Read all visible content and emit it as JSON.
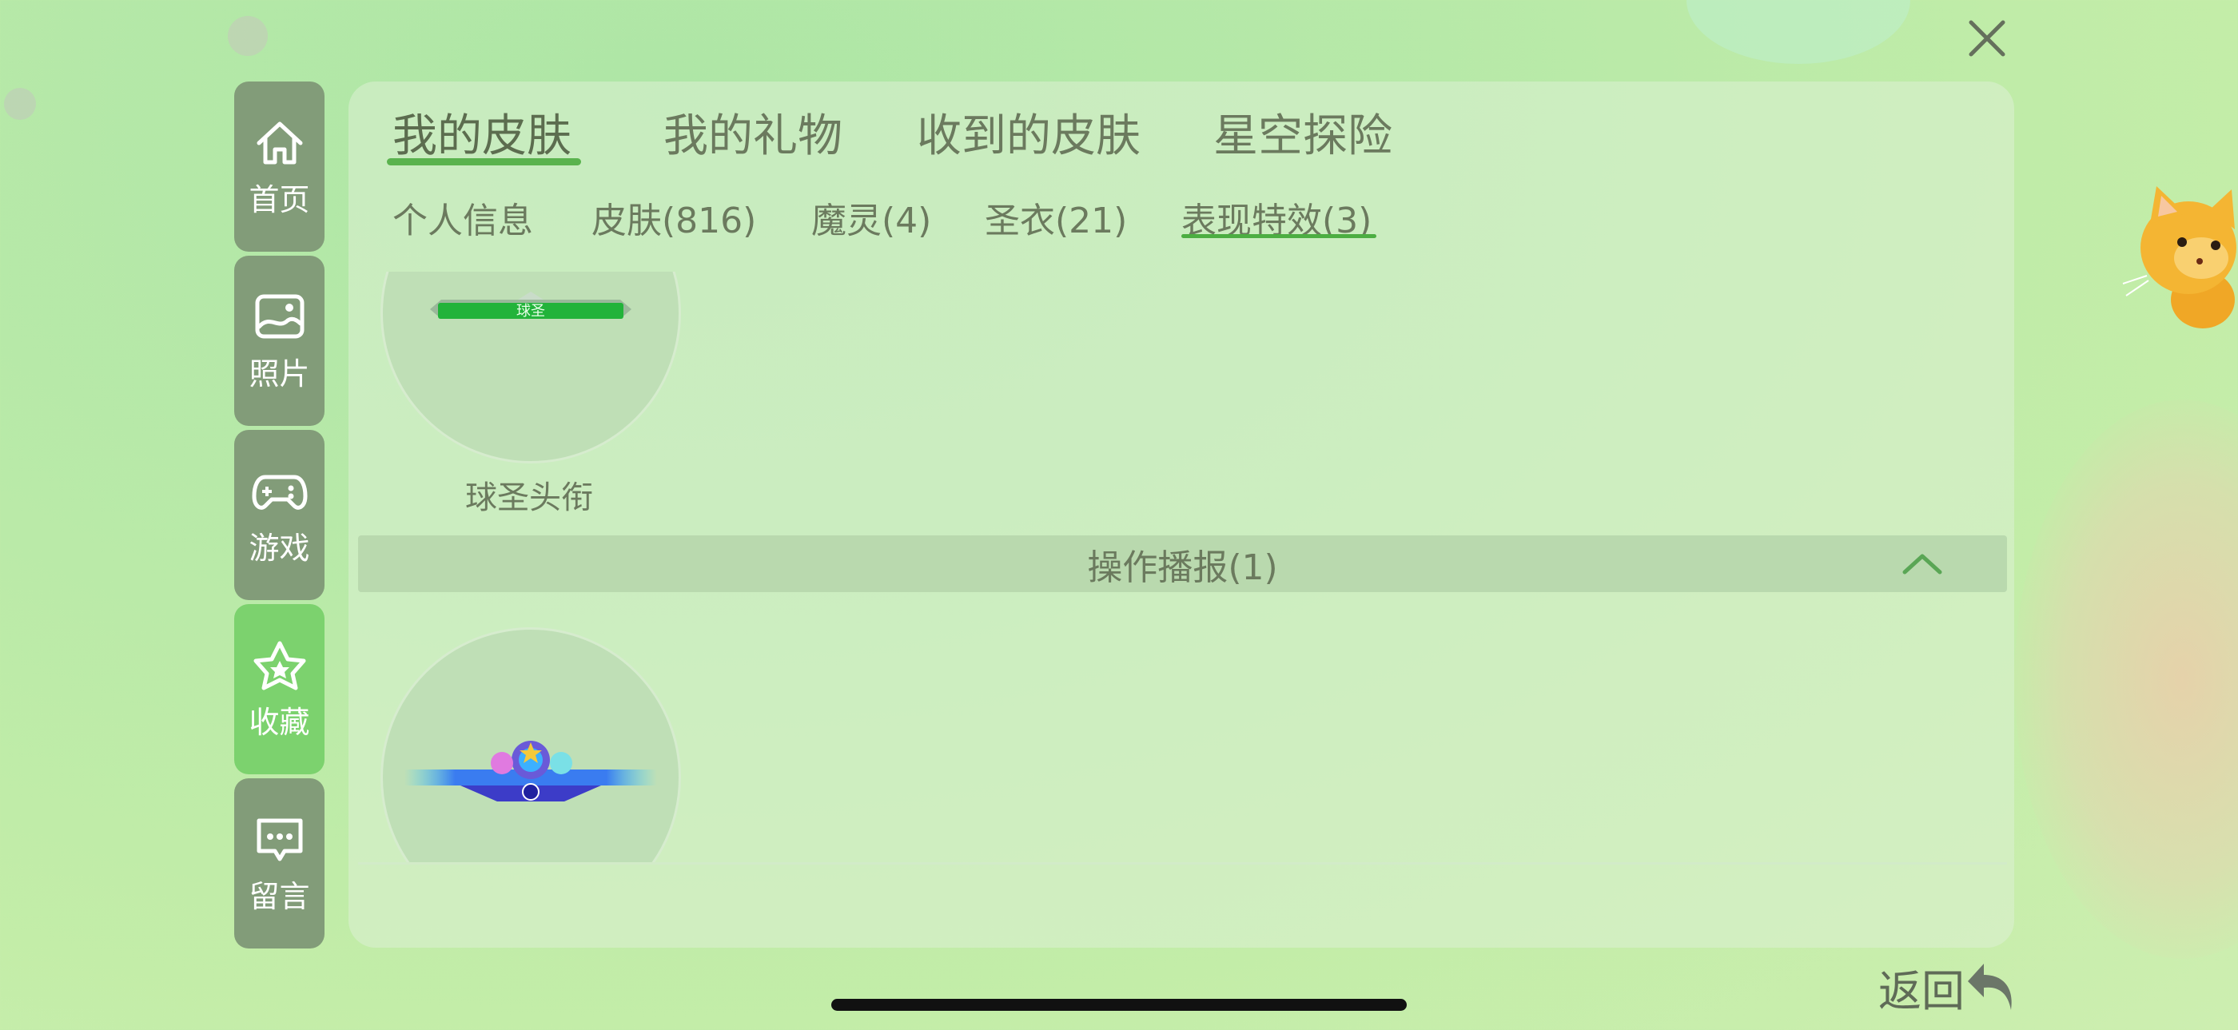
{
  "colors": {
    "nav_bg": "#829c79",
    "nav_active_bg": "#7cd26e",
    "accent_green": "#5ab34e",
    "text": "#6b7a5e"
  },
  "nav": [
    {
      "label": "首页",
      "icon": "home-icon"
    },
    {
      "label": "照片",
      "icon": "photo-icon"
    },
    {
      "label": "游戏",
      "icon": "gamepad-icon"
    },
    {
      "label": "收藏",
      "icon": "star-icon",
      "active": true
    },
    {
      "label": "留言",
      "icon": "message-icon"
    }
  ],
  "top_tabs": [
    {
      "label": "我的皮肤",
      "active": true
    },
    {
      "label": "我的礼物"
    },
    {
      "label": "收到的皮肤"
    },
    {
      "label": "星空探险"
    }
  ],
  "sub_tabs": [
    {
      "label": "个人信息"
    },
    {
      "label": "皮肤(816)"
    },
    {
      "label": "魔灵(4)"
    },
    {
      "label": "圣衣(21)"
    },
    {
      "label": "表现特效(3)",
      "active": true
    }
  ],
  "items": [
    {
      "label": "球圣头衔",
      "badge_text": "球圣"
    }
  ],
  "section": {
    "title": "操作播报(1)",
    "icon": "chevron-up-icon"
  },
  "back": {
    "label": "返回",
    "icon": "back-arrow-icon"
  },
  "close_icon": "close-icon"
}
